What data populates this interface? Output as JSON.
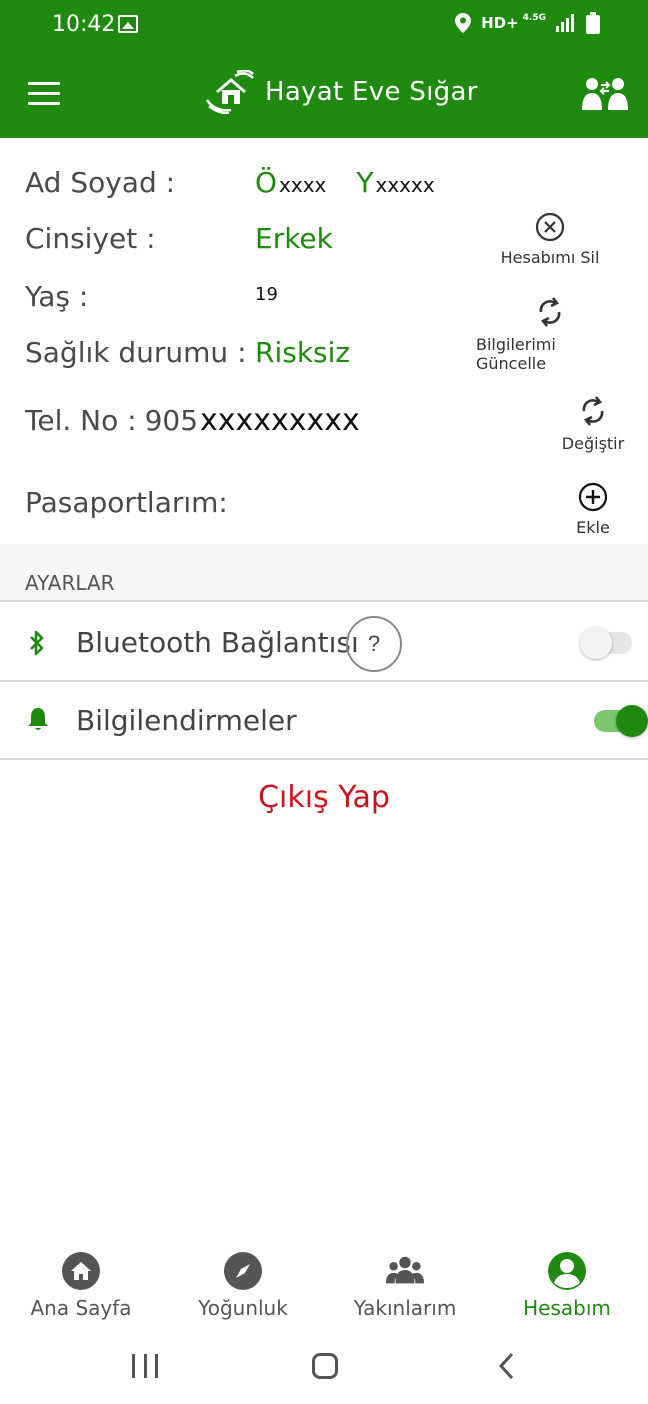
{
  "status_bar": {
    "time": "10:42",
    "network": "HD+",
    "network_sub": "4.5G"
  },
  "app_bar": {
    "title": "Hayat Eve Sığar"
  },
  "profile": {
    "name_label": "Ad Soyad :",
    "first_initial": "Ö",
    "first_rest": "xxxx",
    "last_initial": "Y",
    "last_rest": "xxxxx",
    "gender_label": "Cinsiyet :",
    "gender_value": "Erkek",
    "age_label": "Yaş :",
    "age_value": "19",
    "health_label": "Sağlık durumu :",
    "health_value": "Risksiz",
    "phone_label": "Tel. No :",
    "phone_prefix": "905",
    "phone_masked": "xxxxxxxxx",
    "passports_label": "Pasaportlarım:"
  },
  "actions": {
    "delete_account": "Hesabımı Sil",
    "update_info": "Bilgilerimi Güncelle",
    "change": "Değiştir",
    "add": "Ekle"
  },
  "settings": {
    "header": "AYARLAR",
    "bluetooth_label": "Bluetooth Bağlantısı",
    "bluetooth_help": "?",
    "bluetooth_enabled": false,
    "notifications_label": "Bilgilendirmeler",
    "notifications_enabled": true
  },
  "logout_label": "Çıkış Yap",
  "bottom_nav": [
    {
      "label": "Ana Sayfa",
      "icon": "home-icon",
      "active": false
    },
    {
      "label": "Yoğunluk",
      "icon": "compass-icon",
      "active": false
    },
    {
      "label": "Yakınlarım",
      "icon": "group-icon",
      "active": false
    },
    {
      "label": "Hesabım",
      "icon": "account-icon",
      "active": true
    }
  ],
  "colors": {
    "primary": "#1f8a0f",
    "logout": "#c8161d"
  }
}
